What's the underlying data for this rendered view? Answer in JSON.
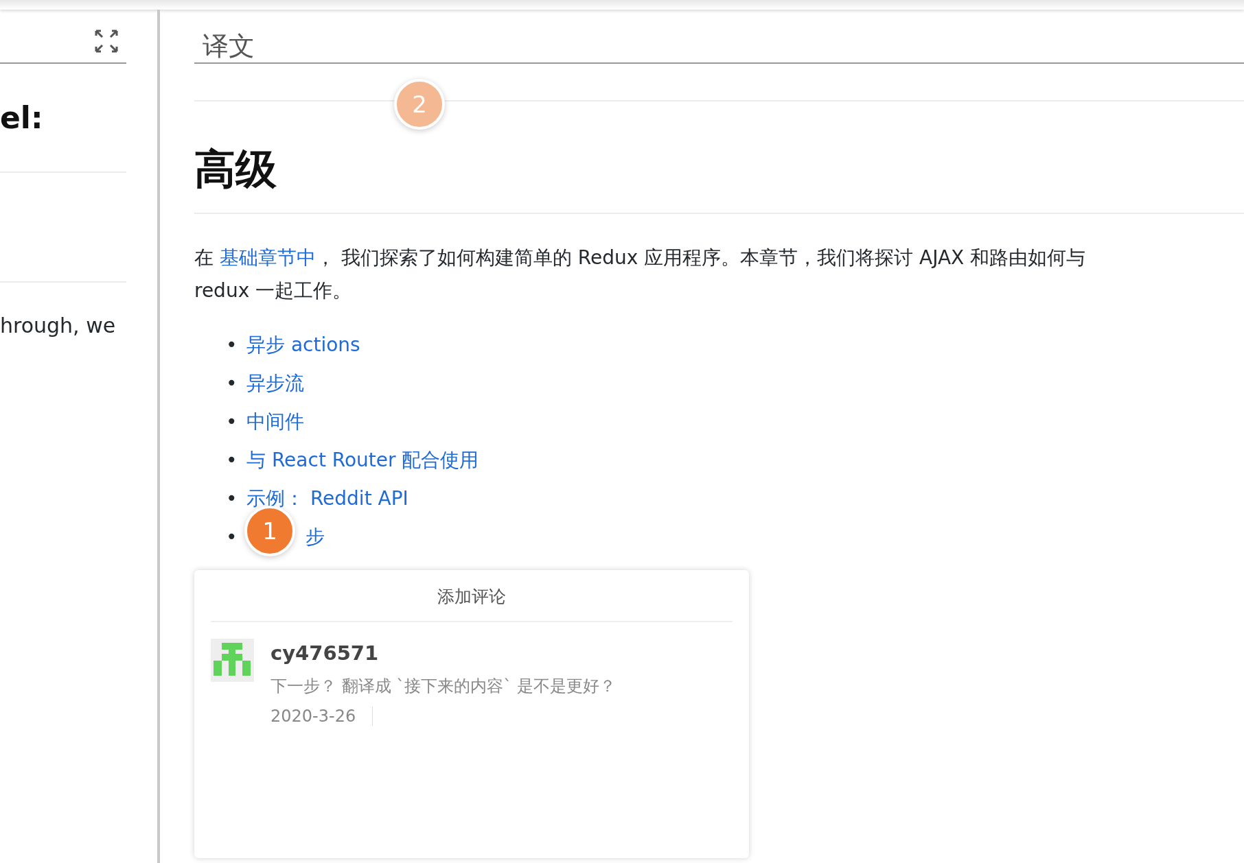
{
  "left_panel": {
    "heading_fragment": "el:",
    "text_fragment": "hrough, we"
  },
  "translation_tab": {
    "label": "译文"
  },
  "markers": [
    {
      "label": "2",
      "active": false
    },
    {
      "label": "1",
      "active": true
    }
  ],
  "heading": "高级",
  "paragraph": [
    {
      "text": "在 ",
      "kind": "plain"
    },
    {
      "text": "基础章节中",
      "kind": "link"
    },
    {
      "text": "， 我们探索了如何构建简单的 Redux 应用程序。本章节，我们将探讨 AJAX 和路由如何与 redux 一起工作。",
      "kind": "plain"
    }
  ],
  "toc": [
    {
      "bullet": "•",
      "label": "异步 actions"
    },
    {
      "bullet": "•",
      "label": "异步流"
    },
    {
      "bullet": "•",
      "label": "中间件"
    },
    {
      "bullet": "•",
      "label": "与 React Router 配合使用"
    },
    {
      "bullet": "•",
      "label": "示例： Reddit API"
    },
    {
      "bullet": "•",
      "label": "步"
    }
  ],
  "comments_panel": {
    "title": "添加评论",
    "comments": [
      {
        "user": "cy476571",
        "text": "下一步？ 翻译成 `接下来的内容` 是不是更好？",
        "date": "2020-3-26"
      }
    ]
  }
}
